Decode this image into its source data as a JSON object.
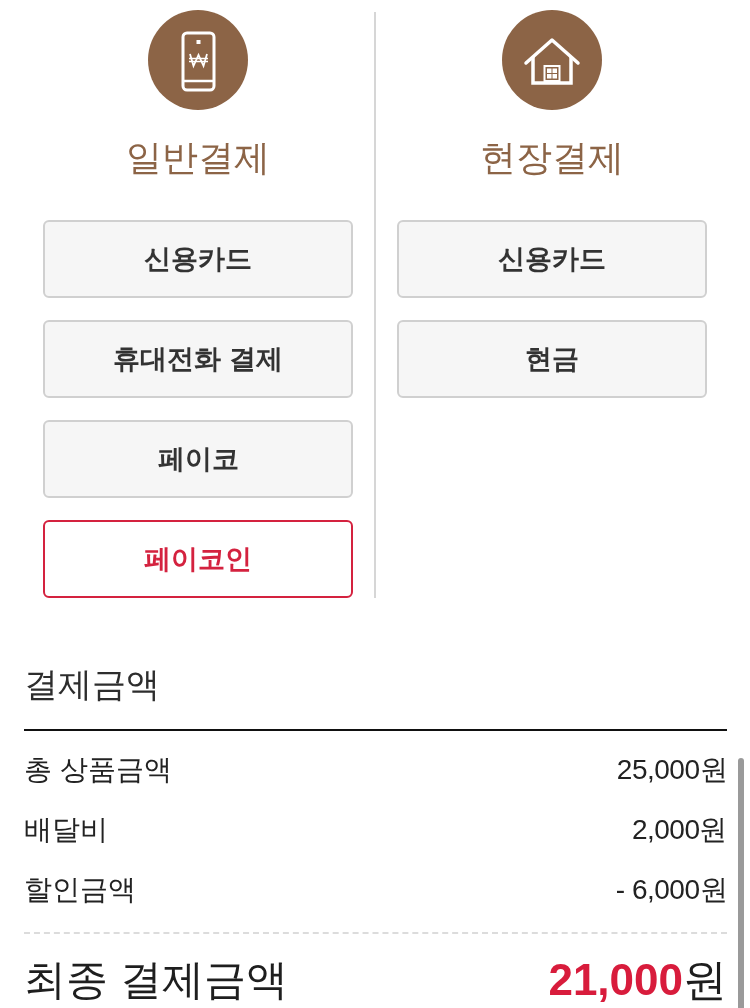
{
  "payment_methods": [
    {
      "title": "일반결제",
      "kind": "online",
      "options": [
        {
          "label": "신용카드",
          "selected": false
        },
        {
          "label": "휴대전화 결제",
          "selected": false
        },
        {
          "label": "페이코",
          "selected": false
        },
        {
          "label": "페이코인",
          "selected": true
        }
      ]
    },
    {
      "title": "현장결제",
      "kind": "onsite",
      "options": [
        {
          "label": "신용카드",
          "selected": false
        },
        {
          "label": "현금",
          "selected": false
        }
      ]
    }
  ],
  "summary": {
    "title": "결제금액",
    "rows": [
      {
        "label": "총 상품금액",
        "value": "25,000원"
      },
      {
        "label": "배달비",
        "value": "2,000원"
      },
      {
        "label": "할인금액",
        "value": "- 6,000원"
      }
    ],
    "total": {
      "label": "최종 결제금액",
      "value": "**21,000**원"
    }
  }
}
